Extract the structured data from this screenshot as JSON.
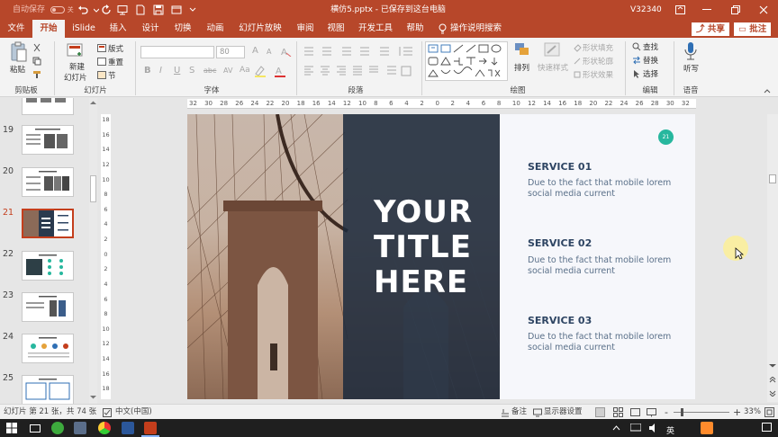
{
  "titlebar": {
    "autosave_label": "自动保存",
    "autosave_state": "关",
    "doc_title": "横仿5.pptx - 已保存到这台电脑",
    "user_name": "V32340",
    "colors": {
      "bar": "#b7472a"
    }
  },
  "menu": {
    "tabs": [
      "文件",
      "开始",
      "iSlide",
      "插入",
      "设计",
      "切换",
      "动画",
      "幻灯片放映",
      "审阅",
      "视图",
      "开发工具",
      "帮助"
    ],
    "active_tab": "开始",
    "search_placeholder": "操作说明搜索",
    "share_label": "共享",
    "comment_label": "批注"
  },
  "ribbon": {
    "clipboard": {
      "paste": "粘贴",
      "group": "剪贴板"
    },
    "slides": {
      "new_slide_line1": "新建",
      "new_slide_line2": "幻灯片",
      "layout": "版式",
      "reset": "重置",
      "section": "节",
      "group": "幻灯片"
    },
    "font": {
      "font_name": "",
      "font_size": "80",
      "grow": "A",
      "shrink": "A",
      "bold": "B",
      "italic": "I",
      "underline": "U",
      "strike": "S",
      "shadow": "abc",
      "spacing": "AV",
      "case": "Aa",
      "group": "字体"
    },
    "paragraph": {
      "group": "段落"
    },
    "drawing": {
      "arrange": "排列",
      "quick_styles": "快速样式",
      "shape_fill": "形状填充",
      "shape_outline": "形状轮廓",
      "shape_effects": "形状效果",
      "group": "绘图"
    },
    "editing": {
      "find": "查找",
      "replace": "替换",
      "select": "选择",
      "group": "编辑"
    },
    "voice": {
      "dictate": "听写",
      "group": "语音"
    }
  },
  "thumbnails": {
    "numbers": [
      "19",
      "20",
      "21",
      "22",
      "23",
      "24",
      "25"
    ],
    "active": "21"
  },
  "slide": {
    "title_lines": [
      "YOUR",
      "TITLE",
      "HERE"
    ],
    "page_badge": "21",
    "services": [
      {
        "heading": "SERVICE 01",
        "text": "Due to the fact that mobile lorem social media current"
      },
      {
        "heading": "SERVICE 02",
        "text": "Due to the fact that mobile lorem social media current"
      },
      {
        "heading": "SERVICE 03",
        "text": "Due to the fact that mobile lorem social media current"
      }
    ],
    "colors": {
      "overlay": "#1c2a3c",
      "heading": "#2e4563",
      "badge": "#27b79e"
    }
  },
  "rulers": {
    "h_labels": [
      "32",
      "30",
      "28",
      "26",
      "24",
      "22",
      "20",
      "18",
      "16",
      "14",
      "12",
      "10",
      "8",
      "6",
      "4",
      "2",
      "0",
      "2",
      "4",
      "6",
      "8",
      "10",
      "12",
      "14",
      "16",
      "18",
      "20",
      "22",
      "24",
      "26",
      "28",
      "30",
      "32"
    ],
    "v_labels": [
      "18",
      "16",
      "14",
      "12",
      "10",
      "8",
      "6",
      "4",
      "2",
      "0",
      "2",
      "4",
      "6",
      "8",
      "10",
      "12",
      "14",
      "16",
      "18"
    ]
  },
  "statusbar": {
    "slide_info": "幻灯片 第 21 张，共 74 张",
    "language": "中文(中国)",
    "notes": "备注",
    "display_settings": "显示器设置",
    "zoom_minus": "-",
    "zoom_plus": "+",
    "zoom_level": "33%"
  },
  "taskbar": {
    "ime": "英"
  }
}
